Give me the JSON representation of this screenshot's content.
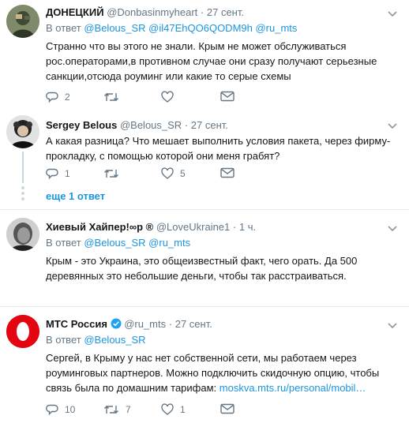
{
  "tweets": [
    {
      "name": "ДОНЕЦКИЙ",
      "handle": "@Donbasinmyheart",
      "sep": "·",
      "time": "27 сент.",
      "reply_prefix": "В ответ",
      "reply_to": "@Belous_SR @il47EhQO6QODM9h @ru_mts",
      "text": "Странно что вы этого не знали. Крым не может обслуживаться рос.операторами,в противном случае они сразу  получают серьезные санкции,отсюда роуминг или какие то серые схемы",
      "replies": "2",
      "retweets": "",
      "likes": ""
    },
    {
      "name": "Sergey Belous",
      "handle": "@Belous_SR",
      "sep": "·",
      "time": "27 сент.",
      "text": "А какая разница? Что мешает выполнить условия пакета, через фирму-прокладку, с помощью которой они меня грабят?",
      "replies": "1",
      "retweets": "",
      "likes": "5"
    },
    {
      "name": "Хиевый Хайпер!∞р ®",
      "handle": "@LoveUkraine1",
      "sep": "·",
      "time": "1 ч.",
      "reply_prefix": "В ответ",
      "reply_to": "@Belous_SR @ru_mts",
      "text": "Крым - это Украина, это общеизвестный факт, чего орать. Да 500 деревянных это небольшие деньги, чтобы так расстраиваться.",
      "replies": "",
      "retweets": "",
      "likes": ""
    },
    {
      "name": "МТС Россия",
      "handle": "@ru_mts",
      "sep": "·",
      "time": "27 сент.",
      "reply_prefix": "В ответ",
      "reply_to": "@Belous_SR",
      "text": "Сергей, в Крыму у нас нет собственной сети, мы работаем через роуминговых партнеров. Можно подключить скидочную опцию, чтобы связь была по домашним тарифам: ",
      "link": "moskva.mts.ru/personal/mobil…",
      "replies": "10",
      "retweets": "7",
      "likes": "1"
    }
  ],
  "more_replies": "еще 1 ответ",
  "colors": {
    "link": "#1b95e0",
    "secondary": "#657786",
    "verified": "#1da1f2",
    "mts_red": "#e30611"
  },
  "icons": [
    "reply-icon",
    "retweet-icon",
    "like-icon",
    "more-icon",
    "verified-icon",
    "chevron-down-icon"
  ]
}
